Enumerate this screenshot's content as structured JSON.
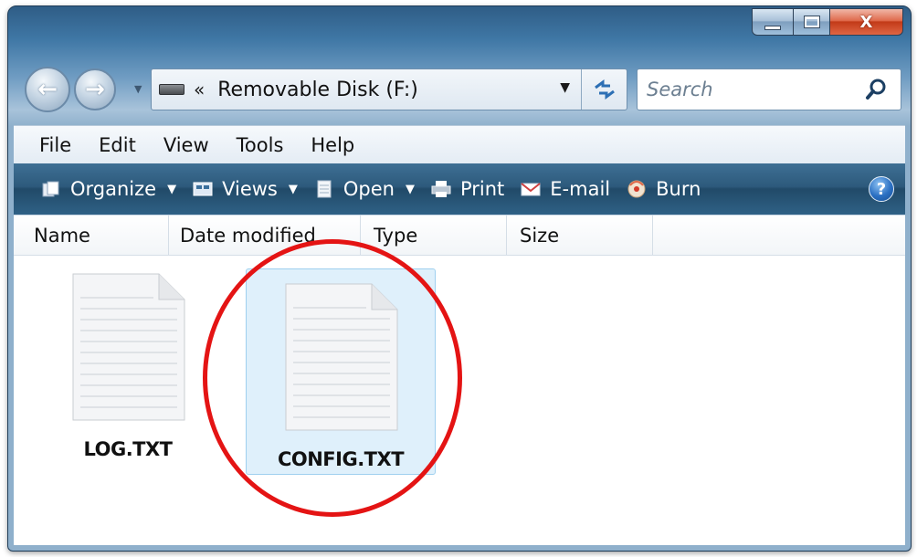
{
  "window": {
    "caption_buttons": [
      "minimize",
      "maximize",
      "close"
    ],
    "close_glyph": "X"
  },
  "navigation": {
    "back_icon": "back-arrow-icon",
    "forward_icon": "forward-arrow-icon",
    "back_glyph": "←",
    "forward_glyph": "→",
    "address_prefix": "«",
    "address_text": "Removable Disk (F:)",
    "dropdown_glyph": "▼",
    "refresh_glyph": "↯"
  },
  "search": {
    "placeholder": "Search"
  },
  "menu": {
    "file": "File",
    "edit": "Edit",
    "view": "View",
    "tools": "Tools",
    "help": "Help"
  },
  "commands": {
    "organize": "Organize",
    "views": "Views",
    "open": "Open",
    "print": "Print",
    "email": "E-mail",
    "burn": "Burn",
    "help_glyph": "?",
    "drop_glyph": "▼"
  },
  "columns": {
    "name": "Name",
    "date_modified": "Date modified",
    "type": "Type",
    "size": "Size"
  },
  "files": [
    {
      "name": "LOG.TXT",
      "selected": false
    },
    {
      "name": "CONFIG.TXT",
      "selected": true
    }
  ],
  "colors": {
    "highlight_ring": "#e41414",
    "selection_fill": "#dff0fb",
    "command_bar": "#2d5a7c"
  }
}
